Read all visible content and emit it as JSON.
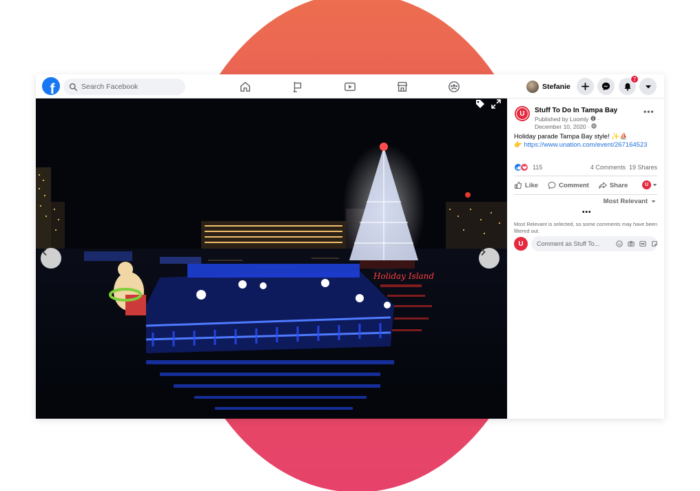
{
  "colors": {
    "brand_blue": "#1877f2",
    "link_blue": "#216fdb",
    "page_red": "#e42a3f",
    "bg_gradient_top": "#ec6e4f",
    "bg_gradient_bottom": "#e6426a"
  },
  "topbar": {
    "logo_letter": "f",
    "search_placeholder": "Search Facebook",
    "nav_icons": [
      "home-icon",
      "flag-icon",
      "watch-icon",
      "marketplace-icon",
      "groups-icon"
    ],
    "profile_name": "Stefanie",
    "notification_count": "7",
    "buttons": [
      "plus-icon",
      "messenger-icon",
      "bell-icon",
      "caret-down-icon"
    ]
  },
  "photo": {
    "tools": [
      "tag-icon",
      "expand-icon"
    ],
    "prev_icon": "chevron-left-icon",
    "next_icon": "chevron-right-icon"
  },
  "post": {
    "page_initial": "U",
    "page_name": "Stuff To Do In Tampa Bay",
    "published_by": "Published by Loomly",
    "date": "December 10, 2020 ·",
    "text": "Holiday parade Tampa Bay style! ✨⛵",
    "link_prefix": "👉",
    "link": "https://www.unation.com/event/267164523",
    "reaction_count": "115",
    "comments_count": "4 Comments",
    "shares_count": "19 Shares",
    "actions": {
      "like": "Like",
      "comment": "Comment",
      "share": "Share"
    },
    "sort_label": "Most Relevant",
    "filter_note": "Most Relevant is selected, so some comments may have been filtered out.",
    "comment_placeholder": "Comment as Stuff To..."
  }
}
